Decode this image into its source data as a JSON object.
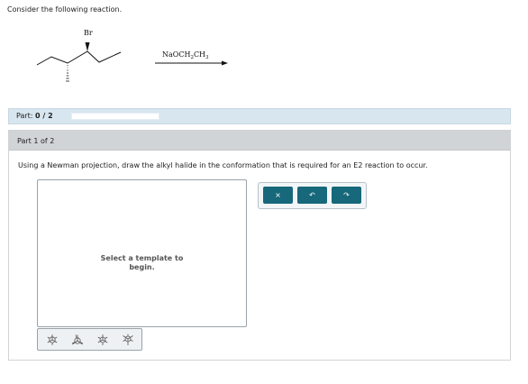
{
  "intro_text": "Consider the following reaction.",
  "reaction": {
    "substituent": "Br",
    "reagent": "NaOCH",
    "reagent_sub1": "2",
    "reagent_mid": "CH",
    "reagent_sub2": "3"
  },
  "progress": {
    "label": "Part:",
    "value": "0 / 2",
    "fraction": 0
  },
  "part_header": "Part 1 of 2",
  "question": "Using a Newman projection, draw the alkyl halide in the conformation that is required for an E2 reaction to occur.",
  "canvas": {
    "message_line1": "Select a template to",
    "message_line2": "begin."
  },
  "toolbar": {
    "clear_icon": "×",
    "undo_icon": "↶",
    "redo_icon": "↷"
  },
  "templates": [
    "newman-staggered-icon",
    "newman-eclipsed-icon",
    "newman-staggered-alt-icon",
    "newman-gauche-icon"
  ],
  "colors": {
    "toolbar_button": "#17687a",
    "part_bar": "#d8e6ef",
    "panel_header": "#d1d4d7"
  }
}
